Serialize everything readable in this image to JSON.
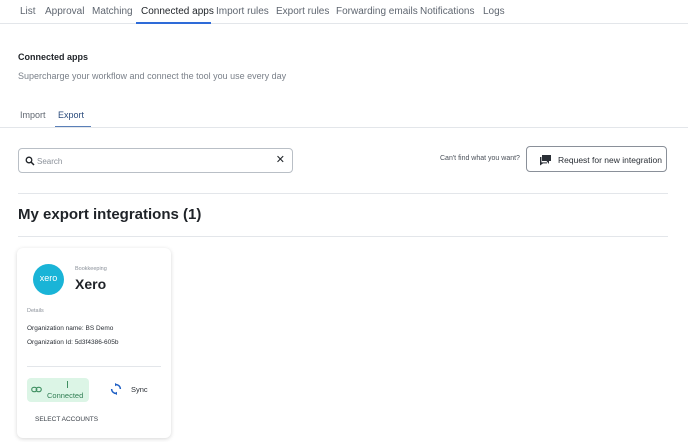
{
  "nav": {
    "tabs": [
      {
        "label": "List"
      },
      {
        "label": "Approval"
      },
      {
        "label": "Matching"
      },
      {
        "label": "Connected apps"
      },
      {
        "label": "Import rules"
      },
      {
        "label": "Export rules"
      },
      {
        "label": "Forwarding emails"
      },
      {
        "label": "Notifications"
      },
      {
        "label": "Logs"
      }
    ],
    "active": "Connected apps"
  },
  "header": {
    "title": "Connected apps",
    "subtitle": "Supercharge your workflow and connect the tool you use every day"
  },
  "subtabs": {
    "items": [
      {
        "label": "Import"
      },
      {
        "label": "Export"
      }
    ],
    "active": "Export"
  },
  "search": {
    "placeholder": "Search",
    "value": "",
    "clear_icon": "close-icon",
    "icon": "search-icon"
  },
  "request": {
    "prompt": "Can't find what you want?",
    "button_label": "Request for new integration",
    "icon": "chat-icon"
  },
  "section": {
    "title": "My export integrations (1)"
  },
  "integrations": [
    {
      "logo_text": "xero",
      "category": "Bookkeeping",
      "name": "Xero",
      "details_label": "Details",
      "org_name": "Organization name: BS Demo",
      "org_id": "Organization Id: 5d3f4386-605b",
      "status_label": "Connected",
      "sync_label": "Sync",
      "select_accounts_label": "SELECT ACCOUNTS"
    }
  ],
  "colors": {
    "accent": "#2e6bd8",
    "xero_brand": "#1ab4d7",
    "connected_bg": "#dcf5e6",
    "connected_text": "#2f7d52",
    "sync_icon": "#1f5fc4"
  }
}
